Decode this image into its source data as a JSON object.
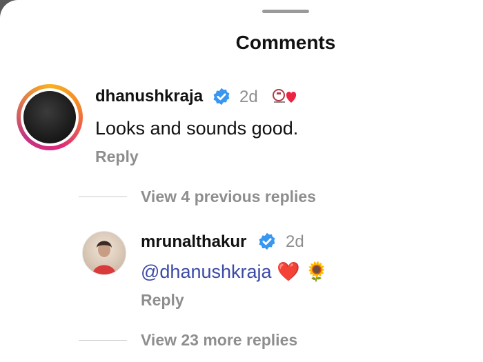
{
  "sheet": {
    "title": "Comments"
  },
  "comments": [
    {
      "username": "dhanushkraja",
      "verified": true,
      "time": "2d",
      "text": "Looks and sounds good.",
      "reply_label": "Reply",
      "badge": "logo-heart-reaction"
    }
  ],
  "thread": {
    "view_previous_label": "View 4 previous replies",
    "reply": {
      "username": "mrunalthakur",
      "verified": true,
      "time": "2d",
      "mention": "@dhanushkraja",
      "emojis": "❤️ 🌻",
      "reply_label": "Reply"
    },
    "view_more_label": "View 23 more replies"
  },
  "colors": {
    "verified_blue": "#3897f0",
    "mention_color": "#3b4aa6",
    "muted_text": "#8e8e8e"
  }
}
